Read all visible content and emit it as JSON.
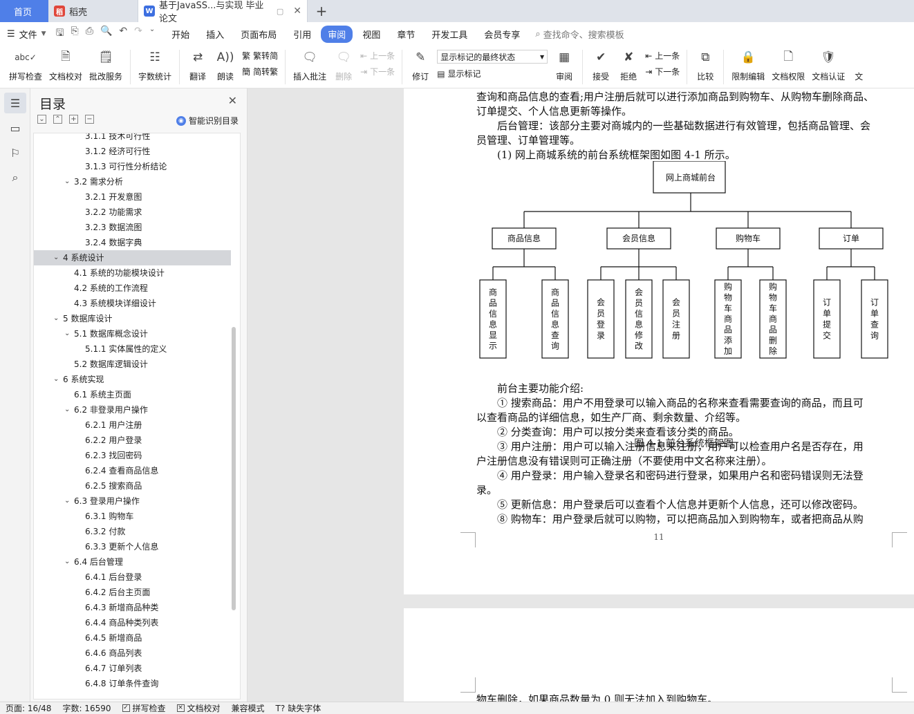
{
  "tabs": {
    "home": "首页",
    "tab1": "稻壳",
    "tab2": "基于JavaSS...与实现 毕业论文"
  },
  "menu": {
    "file": "文件",
    "items": [
      "开始",
      "插入",
      "页面布局",
      "引用",
      "审阅",
      "视图",
      "章节",
      "开发工具",
      "会员专享"
    ],
    "active": "审阅",
    "search_placeholder": "查找命令、搜索模板"
  },
  "ribbon": {
    "spellcheck": "拼写检查",
    "doc_proof": "文档校对",
    "annotate_service": "批改服务",
    "word_count": "字数统计",
    "translate": "翻译",
    "read_aloud": "朗读",
    "to_traditional": "繁转简",
    "to_simplified": "简转繁",
    "insert_comment": "插入批注",
    "delete": "删除",
    "prev": "上一条",
    "next": "下一条",
    "revise": "修订",
    "markup_state": "显示标记的最终状态",
    "show_markup": "显示标记",
    "review": "审阅",
    "accept": "接受",
    "reject": "拒绝",
    "prev2": "上一条",
    "next2": "下一条",
    "compare": "比较",
    "restrict_edit": "限制编辑",
    "doc_rights": "文档权限",
    "doc_auth": "文档认证",
    "more": "文"
  },
  "toc": {
    "title": "目录",
    "smart": "智能识别目录",
    "items": [
      {
        "num": "3.1.1",
        "text": "技术可行性",
        "level": 3,
        "arrow": false
      },
      {
        "num": "3.1.2",
        "text": "经济可行性",
        "level": 3,
        "arrow": false
      },
      {
        "num": "3.1.3",
        "text": "可行性分析结论",
        "level": 3,
        "arrow": false
      },
      {
        "num": "3.2",
        "text": "需求分析",
        "level": 2,
        "arrow": true
      },
      {
        "num": "3.2.1",
        "text": "开发意图",
        "level": 3,
        "arrow": false
      },
      {
        "num": "3.2.2",
        "text": "功能需求",
        "level": 3,
        "arrow": false
      },
      {
        "num": "3.2.3",
        "text": "数据流图",
        "level": 3,
        "arrow": false
      },
      {
        "num": "3.2.4",
        "text": "数据字典",
        "level": 3,
        "arrow": false
      },
      {
        "num": "4",
        "text": "系统设计",
        "level": 1,
        "arrow": true,
        "selected": true
      },
      {
        "num": "4.1",
        "text": "系统的功能模块设计",
        "level": 2,
        "arrow": false
      },
      {
        "num": "4.2",
        "text": "系统的工作流程",
        "level": 2,
        "arrow": false
      },
      {
        "num": "4.3",
        "text": "系统模块详细设计",
        "level": 2,
        "arrow": false
      },
      {
        "num": "5",
        "text": "数据库设计",
        "level": 1,
        "arrow": true
      },
      {
        "num": "5.1",
        "text": "数据库概念设计",
        "level": 2,
        "arrow": true
      },
      {
        "num": "5.1.1",
        "text": "实体属性的定义",
        "level": 3,
        "arrow": false
      },
      {
        "num": "5.2",
        "text": "数据库逻辑设计",
        "level": 2,
        "arrow": false
      },
      {
        "num": "6",
        "text": "系统实现",
        "level": 1,
        "arrow": true
      },
      {
        "num": "6.1",
        "text": "系统主页面",
        "level": 2,
        "arrow": false
      },
      {
        "num": "6.2",
        "text": "非登录用户操作",
        "level": 2,
        "arrow": true
      },
      {
        "num": "6.2.1",
        "text": "用户注册",
        "level": 3,
        "arrow": false
      },
      {
        "num": "6.2.2",
        "text": "用户登录",
        "level": 3,
        "arrow": false
      },
      {
        "num": "6.2.3",
        "text": "找回密码",
        "level": 3,
        "arrow": false
      },
      {
        "num": "6.2.4",
        "text": "查看商品信息",
        "level": 3,
        "arrow": false
      },
      {
        "num": "6.2.5",
        "text": "搜索商品",
        "level": 3,
        "arrow": false
      },
      {
        "num": "6.3",
        "text": "登录用户操作",
        "level": 2,
        "arrow": true
      },
      {
        "num": "6.3.1",
        "text": "购物车",
        "level": 3,
        "arrow": false
      },
      {
        "num": "6.3.2",
        "text": "付款",
        "level": 3,
        "arrow": false
      },
      {
        "num": "6.3.3",
        "text": "更新个人信息",
        "level": 3,
        "arrow": false
      },
      {
        "num": "6.4",
        "text": "后台管理",
        "level": 2,
        "arrow": true
      },
      {
        "num": "6.4.1",
        "text": "后台登录",
        "level": 3,
        "arrow": false
      },
      {
        "num": "6.4.2",
        "text": "后台主页面",
        "level": 3,
        "arrow": false
      },
      {
        "num": "6.4.3",
        "text": "新增商品种类",
        "level": 3,
        "arrow": false
      },
      {
        "num": "6.4.4",
        "text": "商品种类列表",
        "level": 3,
        "arrow": false
      },
      {
        "num": "6.4.5",
        "text": "新增商品",
        "level": 3,
        "arrow": false
      },
      {
        "num": "6.4.6",
        "text": "商品列表",
        "level": 3,
        "arrow": false
      },
      {
        "num": "6.4.7",
        "text": "订单列表",
        "level": 3,
        "arrow": false
      },
      {
        "num": "6.4.8",
        "text": "订单条件查询",
        "level": 3,
        "arrow": false
      }
    ]
  },
  "doc": {
    "p_top_1": "查询和商品信息的查看;用户注册后就可以进行添加商品到购物车、从购物车删除商品、",
    "p_top_2": "订单提交、个人信息更新等操作。",
    "p_admin_1": "后台管理：该部分主要对商城内的一些基础数据进行有效管理，包括商品管理、会",
    "p_admin_2": "员管理、订单管理等。",
    "p_fig_intro": "(1)  网上商城系统的前台系统框架图如图 4-1 所示。",
    "figure": {
      "root": "网上商城前台",
      "groups": [
        {
          "name": "商品信息",
          "children": [
            "商品信息显示",
            "商品信息查询"
          ]
        },
        {
          "name": "会员信息",
          "children": [
            "会员登录",
            "会员信息修改",
            "会员注册"
          ]
        },
        {
          "name": "购物车",
          "children": [
            "购物车商品添加",
            "购物车商品删除"
          ]
        },
        {
          "name": "订单",
          "children": [
            "订单提交",
            "订单查询"
          ]
        }
      ],
      "caption": "图 4-1  前台系统框架图"
    },
    "p_func_title": "前台主要功能介绍:",
    "p_f1_1": "①  搜索商品：用户不用登录可以输入商品的名称来查看需要查询的商品，而且可",
    "p_f1_2": "以查看商品的详细信息，如生产厂商、剩余数量、介绍等。",
    "p_f2": "②  分类查询：用户可以按分类来查看该分类的商品。",
    "p_f3_1": "③  用户注册：用户可以输入注册信息来注册，用户可以检查用户名是否存在，用",
    "p_f3_2": "户注册信息没有错误则可正确注册（不要使用中文名称来注册）。",
    "p_f4_1": "④  用户登录：用户输入登录名和密码进行登录，如果用户名和密码错误则无法登",
    "p_f4_2": "录。",
    "p_f5": "⑤  更新信息：用户登录后可以查看个人信息并更新个人信息，还可以修改密码。",
    "p_f6": "⑧  购物车：用户登录后就可以购物，可以把商品加入到购物车，或者把商品从购",
    "page_number": "11",
    "p_next": "物车删除，如果商品数量为 0 则无法加入到购物车。"
  },
  "status": {
    "page": "页面: 16/48",
    "words": "字数: 16590",
    "spell": "拼写检查",
    "proof": "文档校对",
    "compat": "兼容模式",
    "missing_font": "缺失字体"
  }
}
